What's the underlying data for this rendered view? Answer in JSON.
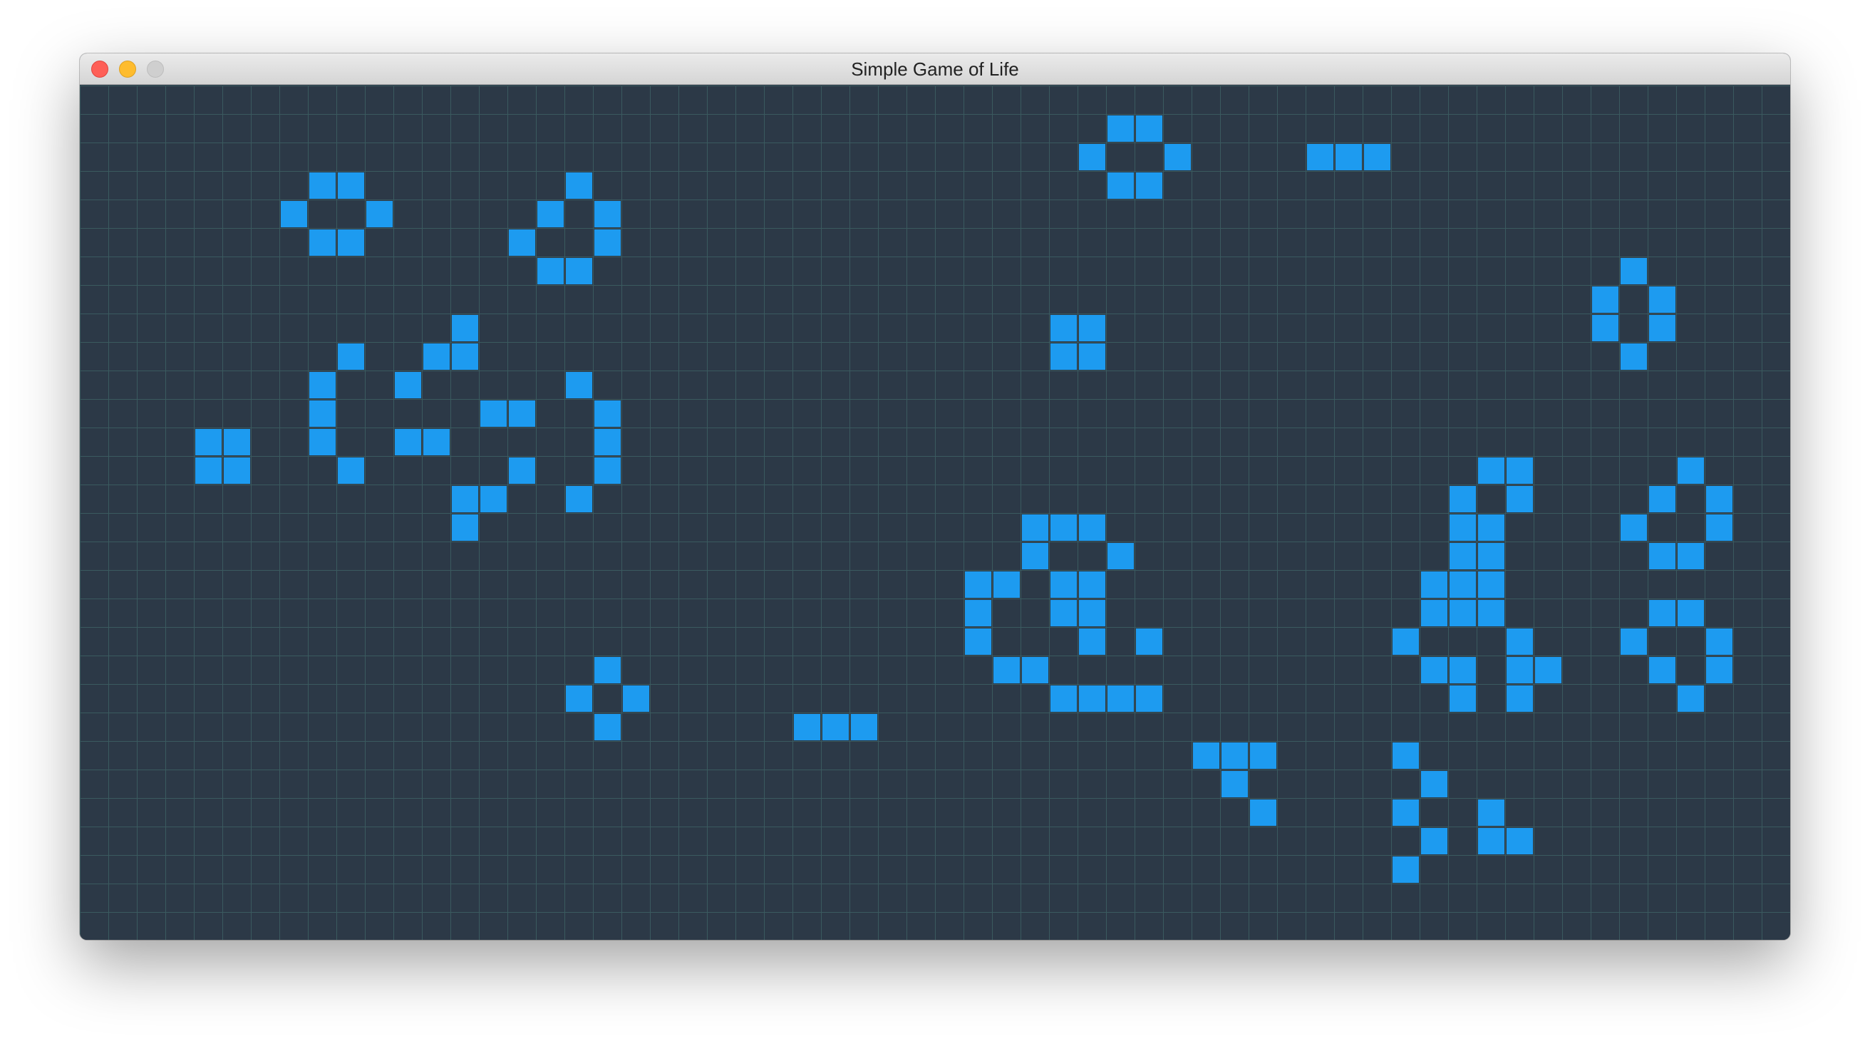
{
  "window": {
    "title": "Simple Game of Life"
  },
  "controls": {
    "close": "close-icon",
    "minimize": "minimize-icon",
    "maximize": "maximize-icon"
  },
  "colors": {
    "board_background": "#2c3947",
    "grid_line": "#3a5a5f",
    "live_cell": "#1d9bf0",
    "close": "#fe5f57",
    "minimize": "#febc2e",
    "maximize_disabled": "#cfcfcf"
  },
  "board": {
    "columns": 60,
    "rows": 30,
    "live_cells": [
      [
        36,
        1
      ],
      [
        37,
        1
      ],
      [
        35,
        2
      ],
      [
        38,
        2
      ],
      [
        43,
        2
      ],
      [
        44,
        2
      ],
      [
        45,
        2
      ],
      [
        36,
        3
      ],
      [
        37,
        3
      ],
      [
        8,
        3
      ],
      [
        9,
        3
      ],
      [
        17,
        3
      ],
      [
        7,
        4
      ],
      [
        10,
        4
      ],
      [
        16,
        4
      ],
      [
        18,
        4
      ],
      [
        8,
        5
      ],
      [
        9,
        5
      ],
      [
        15,
        5
      ],
      [
        18,
        5
      ],
      [
        16,
        6
      ],
      [
        17,
        6
      ],
      [
        54,
        6
      ],
      [
        53,
        7
      ],
      [
        55,
        7
      ],
      [
        13,
        8
      ],
      [
        34,
        8
      ],
      [
        35,
        8
      ],
      [
        53,
        8
      ],
      [
        55,
        8
      ],
      [
        9,
        9
      ],
      [
        12,
        9
      ],
      [
        13,
        9
      ],
      [
        34,
        9
      ],
      [
        35,
        9
      ],
      [
        54,
        9
      ],
      [
        8,
        10
      ],
      [
        11,
        10
      ],
      [
        17,
        10
      ],
      [
        8,
        11
      ],
      [
        14,
        11
      ],
      [
        15,
        11
      ],
      [
        18,
        11
      ],
      [
        4,
        12
      ],
      [
        5,
        12
      ],
      [
        8,
        12
      ],
      [
        11,
        12
      ],
      [
        12,
        12
      ],
      [
        18,
        12
      ],
      [
        4,
        13
      ],
      [
        5,
        13
      ],
      [
        9,
        13
      ],
      [
        15,
        13
      ],
      [
        18,
        13
      ],
      [
        49,
        13
      ],
      [
        50,
        13
      ],
      [
        56,
        13
      ],
      [
        13,
        14
      ],
      [
        14,
        14
      ],
      [
        17,
        14
      ],
      [
        48,
        14
      ],
      [
        50,
        14
      ],
      [
        55,
        14
      ],
      [
        57,
        14
      ],
      [
        13,
        15
      ],
      [
        33,
        15
      ],
      [
        34,
        15
      ],
      [
        35,
        15
      ],
      [
        48,
        15
      ],
      [
        49,
        15
      ],
      [
        54,
        15
      ],
      [
        57,
        15
      ],
      [
        33,
        16
      ],
      [
        36,
        16
      ],
      [
        48,
        16
      ],
      [
        49,
        16
      ],
      [
        55,
        16
      ],
      [
        56,
        16
      ],
      [
        31,
        17
      ],
      [
        32,
        17
      ],
      [
        34,
        17
      ],
      [
        35,
        17
      ],
      [
        47,
        17
      ],
      [
        48,
        17
      ],
      [
        49,
        17
      ],
      [
        31,
        18
      ],
      [
        34,
        18
      ],
      [
        35,
        18
      ],
      [
        47,
        18
      ],
      [
        48,
        18
      ],
      [
        49,
        18
      ],
      [
        55,
        18
      ],
      [
        56,
        18
      ],
      [
        31,
        19
      ],
      [
        35,
        19
      ],
      [
        37,
        19
      ],
      [
        46,
        19
      ],
      [
        50,
        19
      ],
      [
        54,
        19
      ],
      [
        57,
        19
      ],
      [
        32,
        20
      ],
      [
        33,
        20
      ],
      [
        18,
        20
      ],
      [
        47,
        20
      ],
      [
        48,
        20
      ],
      [
        50,
        20
      ],
      [
        51,
        20
      ],
      [
        55,
        20
      ],
      [
        57,
        20
      ],
      [
        17,
        21
      ],
      [
        19,
        21
      ],
      [
        34,
        21
      ],
      [
        35,
        21
      ],
      [
        36,
        21
      ],
      [
        37,
        21
      ],
      [
        48,
        21
      ],
      [
        50,
        21
      ],
      [
        56,
        21
      ],
      [
        18,
        22
      ],
      [
        25,
        22
      ],
      [
        26,
        22
      ],
      [
        27,
        22
      ],
      [
        39,
        23
      ],
      [
        40,
        23
      ],
      [
        41,
        23
      ],
      [
        46,
        23
      ],
      [
        40,
        24
      ],
      [
        47,
        24
      ],
      [
        41,
        25
      ],
      [
        46,
        25
      ],
      [
        49,
        25
      ],
      [
        47,
        26
      ],
      [
        49,
        26
      ],
      [
        50,
        26
      ],
      [
        46,
        27
      ]
    ]
  }
}
